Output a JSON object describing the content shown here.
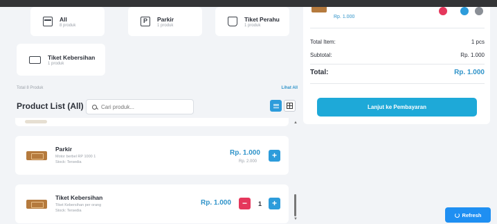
{
  "categories": [
    {
      "name": "All",
      "count": "8 produk",
      "icon": "all-icon"
    },
    {
      "name": "Parkir",
      "count": "1 produk",
      "icon": "parking-icon"
    },
    {
      "name": "Tiket Perahu",
      "count": "1 produk",
      "icon": "boat-icon"
    },
    {
      "name": "Tiket Kebersihan",
      "count": "1 produk",
      "icon": "ticket-icon"
    }
  ],
  "parking_glyph": "P",
  "total_label": "Total 8 Produk",
  "see_all": "Lihat All",
  "product_list_title": "Product List (All)",
  "search_placeholder": "Cari produk...",
  "products": [
    {
      "name": "Parkir",
      "description": "Motor berbel RP 1000 1",
      "stock": "Stock: Tersedia",
      "price": "Rp. 1.000",
      "original_price": "Rp. 2.000",
      "add_label": "+"
    },
    {
      "name": "Tiket Kebersihan",
      "description": "Tiket Kebersihan per orang",
      "stock": "Stock: Tersedia",
      "price": "Rp. 1.000",
      "quantity": "1",
      "minus_label": "−",
      "add_label": "+"
    }
  ],
  "cart": {
    "item_price": "Rp. 1.000",
    "total_item_label": "Total Item:",
    "total_item_value": "1 pcs",
    "subtotal_label": "Subtotal:",
    "subtotal_value": "Rp. 1.000",
    "total_label": "Total:",
    "total_value": "Rp. 1.000",
    "pay_button": "Lanjut ke Pembayaran",
    "dot_colors": [
      "#e5375c",
      "#2d9cdb",
      "#8a8f96"
    ]
  },
  "refresh_button": "Refresh",
  "scroll_up_glyph": "▲",
  "scroll_down_glyph": "▼",
  "colors": {
    "accent": "#2d9cdb",
    "danger": "#e5375c",
    "price": "#2f93c9"
  }
}
